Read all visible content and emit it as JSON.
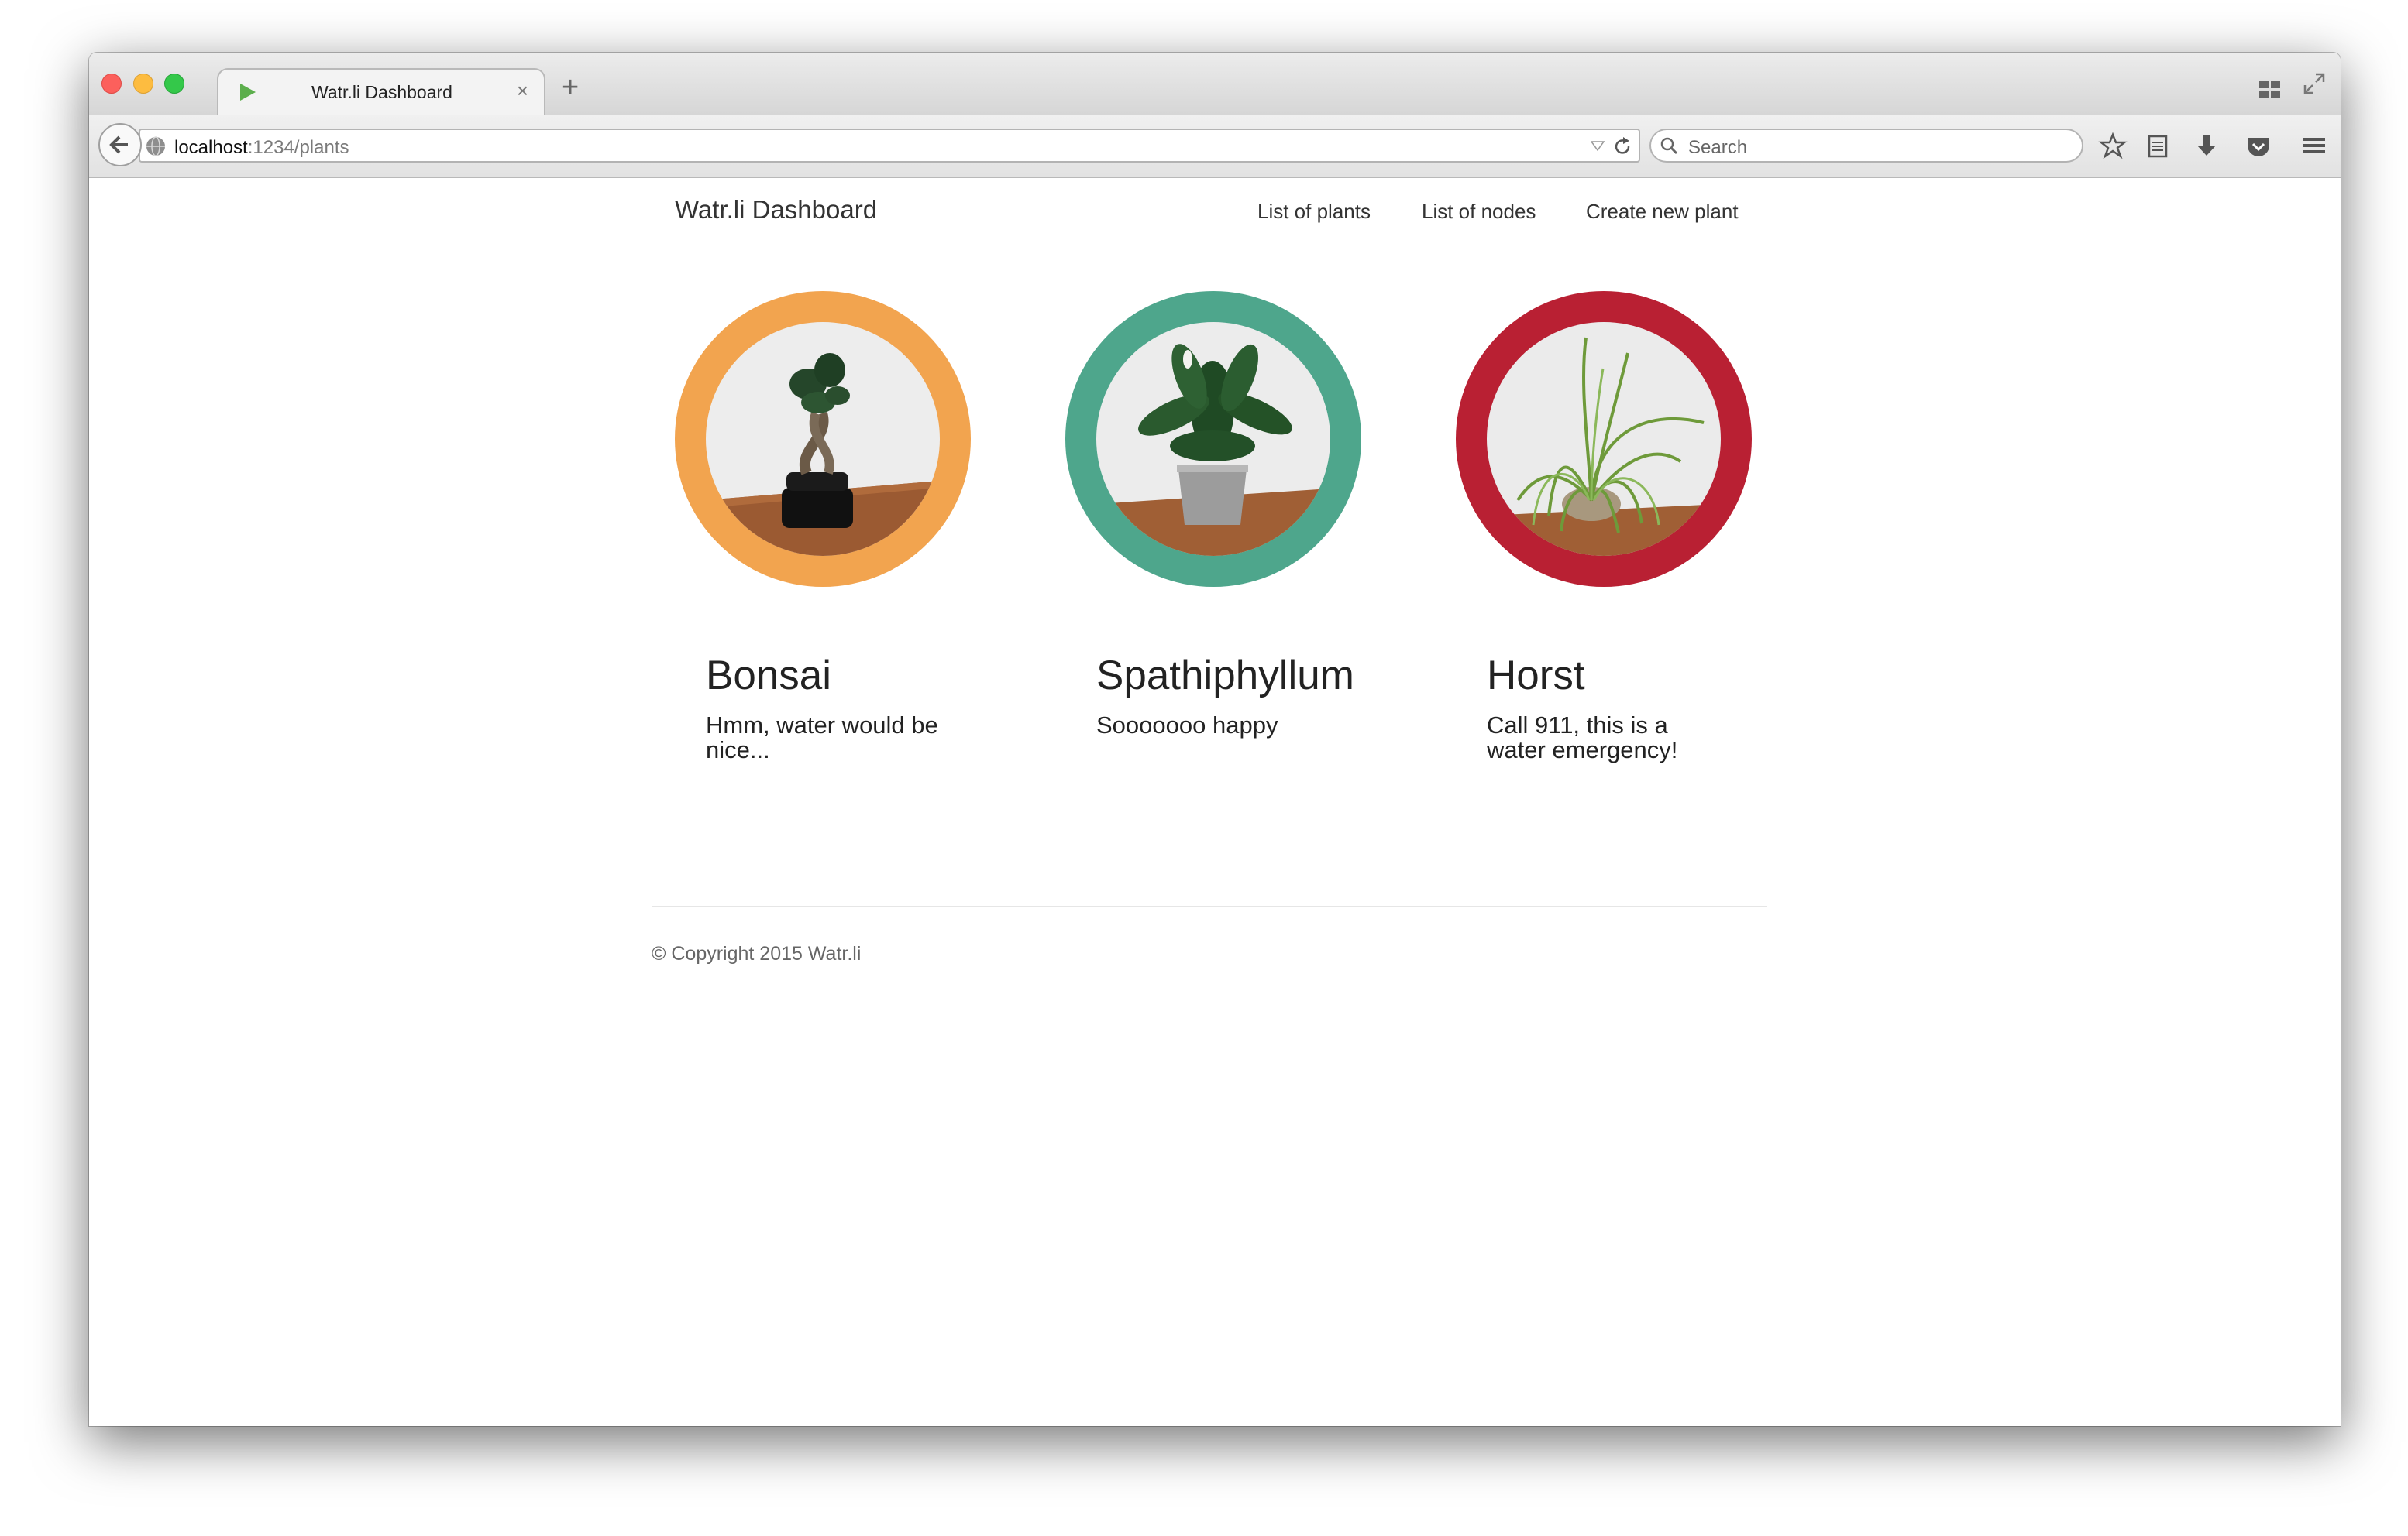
{
  "browser": {
    "tab_title": "Watr.li Dashboard",
    "new_tab_label": "+",
    "close_tab_label": "×",
    "url_host": "localhost",
    "url_path": ":1234/plants",
    "search_placeholder": "Search"
  },
  "header": {
    "brand": "Watr.li Dashboard",
    "nav": [
      {
        "label": "List of plants"
      },
      {
        "label": "List of nodes"
      },
      {
        "label": "Create new plant"
      }
    ]
  },
  "plants": [
    {
      "name": "Bonsai",
      "status": "Hmm, water would be nice...",
      "ring_color": "#f2a44f"
    },
    {
      "name": "Spathiphyllum",
      "status": "Sooooooo happy",
      "ring_color": "#4ea68c"
    },
    {
      "name": "Horst",
      "status": "Call 911, this is a water emergency!",
      "ring_color": "#b92033"
    }
  ],
  "footer": {
    "copyright": "© Copyright 2015 Watr.li"
  },
  "colors": {
    "favicon_green": "#5cae4c",
    "text": "#333333"
  }
}
